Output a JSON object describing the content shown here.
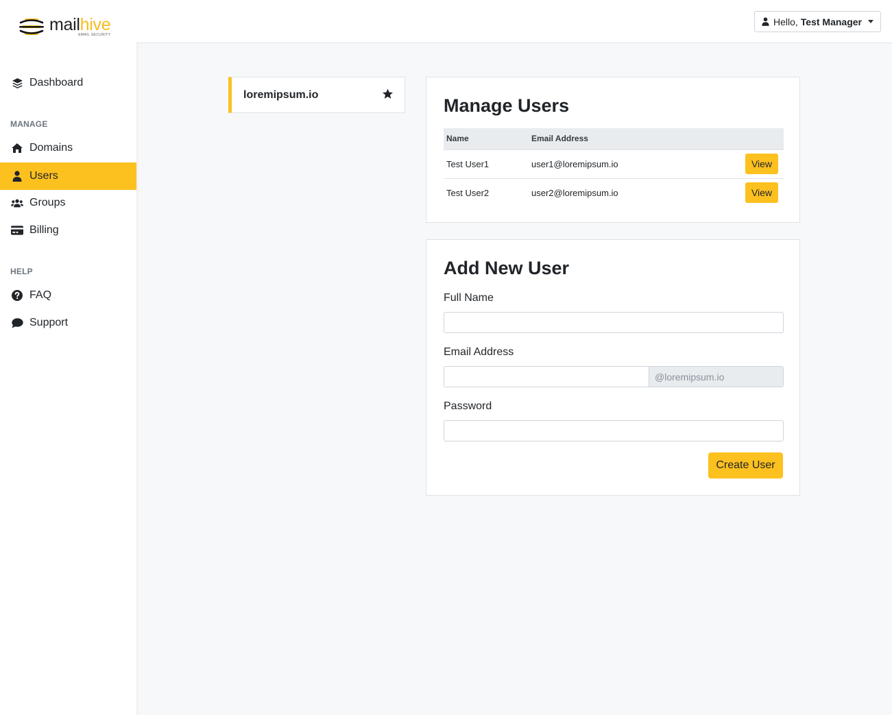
{
  "logo": {
    "word_main": "mail",
    "word_accent": "hive",
    "tagline": "EMAIL SECURITY"
  },
  "sidebar": {
    "items": [
      {
        "label": "Dashboard",
        "icon": "layers-icon"
      },
      {
        "label": "Domains",
        "icon": "home-icon"
      },
      {
        "label": "Users",
        "icon": "user-icon",
        "active": true
      },
      {
        "label": "Groups",
        "icon": "users-icon"
      },
      {
        "label": "Billing",
        "icon": "credit-card-icon"
      },
      {
        "label": "FAQ",
        "icon": "question-circle-icon"
      },
      {
        "label": "Support",
        "icon": "comment-icon"
      }
    ],
    "sections": {
      "manage": "MANAGE",
      "help": "HELP"
    }
  },
  "topbar": {
    "greeting": "Hello,",
    "user_name": "Test Manager"
  },
  "domain": {
    "name": "loremipsum.io"
  },
  "manage_users": {
    "title": "Manage Users",
    "columns": [
      "Name",
      "Email Address"
    ],
    "rows": [
      {
        "name": "Test User1",
        "email": "user1@loremipsum.io",
        "action": "View"
      },
      {
        "name": "Test User2",
        "email": "user2@loremipsum.io",
        "action": "View"
      }
    ]
  },
  "add_user": {
    "title": "Add New User",
    "full_name_label": "Full Name",
    "email_label": "Email Address",
    "email_suffix": "@loremipsum.io",
    "password_label": "Password",
    "submit_label": "Create User"
  },
  "colors": {
    "accent": "#fcc01f",
    "background": "#f7f8f9"
  }
}
